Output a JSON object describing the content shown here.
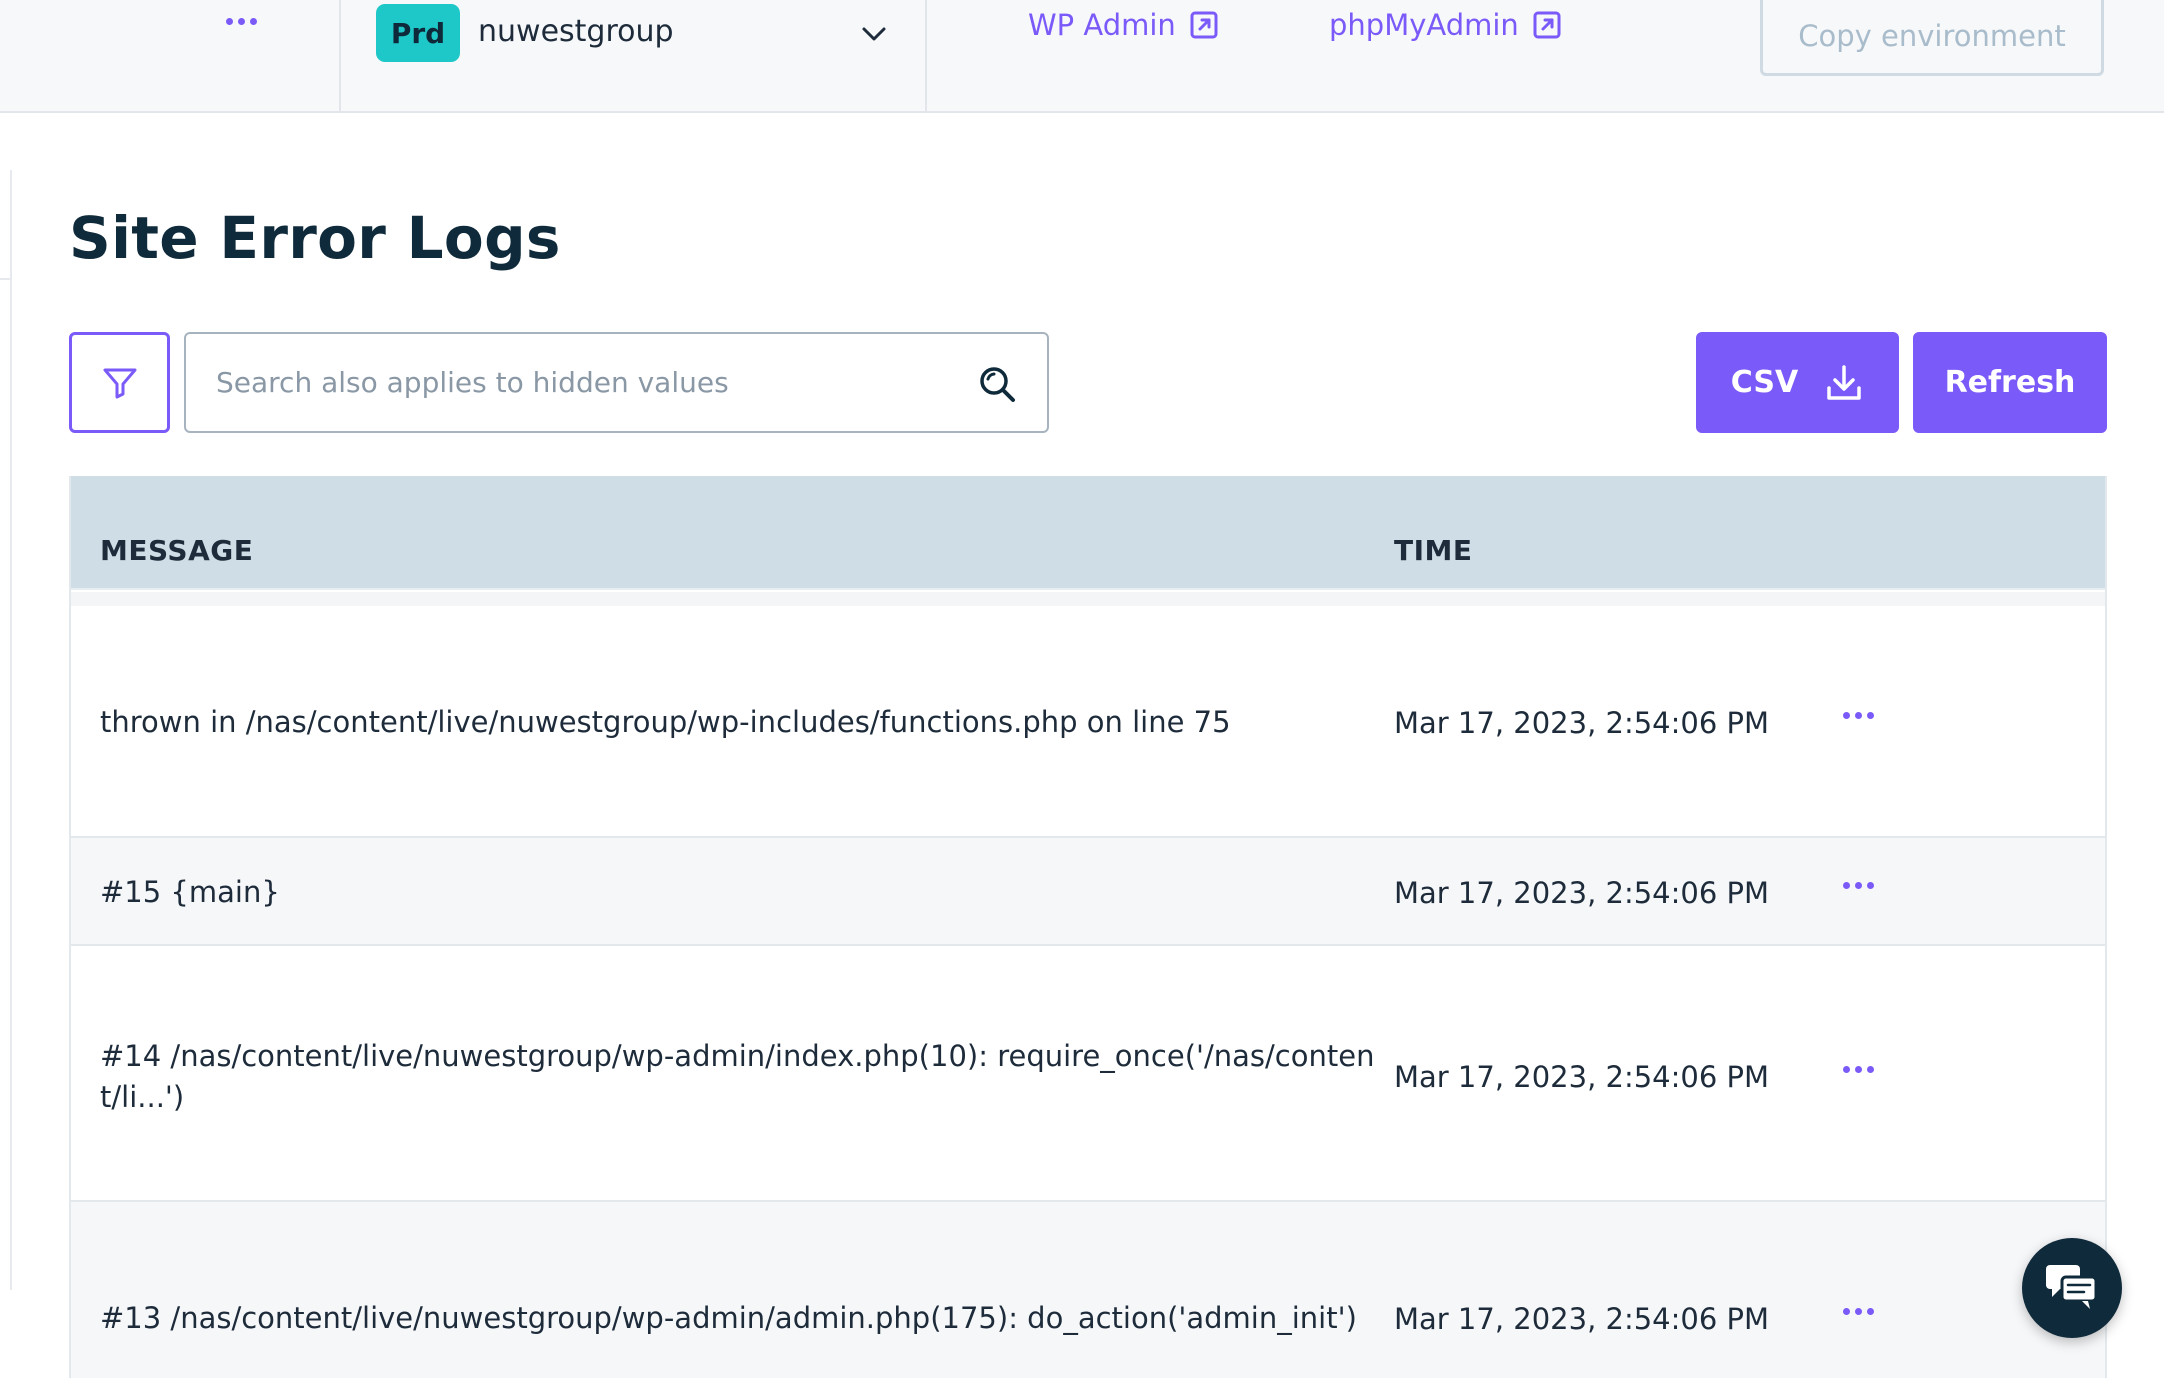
{
  "header": {
    "env_badge": "Prd",
    "env_name": "nuwestgroup",
    "links": [
      {
        "label": "WP Admin"
      },
      {
        "label": "phpMyAdmin"
      }
    ],
    "copy_button": "Copy environment"
  },
  "page": {
    "title": "Site Error Logs"
  },
  "toolbar": {
    "search_placeholder": "Search also applies to hidden values",
    "csv_label": "CSV",
    "refresh_label": "Refresh"
  },
  "table": {
    "columns": [
      "MESSAGE",
      "TIME"
    ],
    "rows": [
      {
        "message": "thrown in /nas/content/live/nuwestgroup/wp-includes/functions.php on line 75",
        "time": "Mar 17, 2023, 2:54:06 PM"
      },
      {
        "message": "#15 {main}",
        "time": "Mar 17, 2023, 2:54:06 PM"
      },
      {
        "message": "#14 /nas/content/live/nuwestgroup/wp-admin/index.php(10): require_once('/nas/content/li...')",
        "time": "Mar 17, 2023, 2:54:06 PM"
      },
      {
        "message": "#13 /nas/content/live/nuwestgroup/wp-admin/admin.php(175): do_action('admin_init')",
        "time": "Mar 17, 2023, 2:54:06 PM"
      }
    ]
  },
  "colors": {
    "accent": "#7a5af8",
    "badge": "#1fc8c8",
    "table_header": "#cfdde7",
    "title": "#0f2a3a"
  },
  "icons": {
    "top_menu": "more-horizontal-icon",
    "env_dropdown": "chevron-down-icon",
    "external_link": "external-link-icon",
    "filter": "filter-icon",
    "search": "search-icon",
    "download": "download-icon",
    "row_menu": "more-horizontal-icon",
    "chat": "chat-icon"
  }
}
